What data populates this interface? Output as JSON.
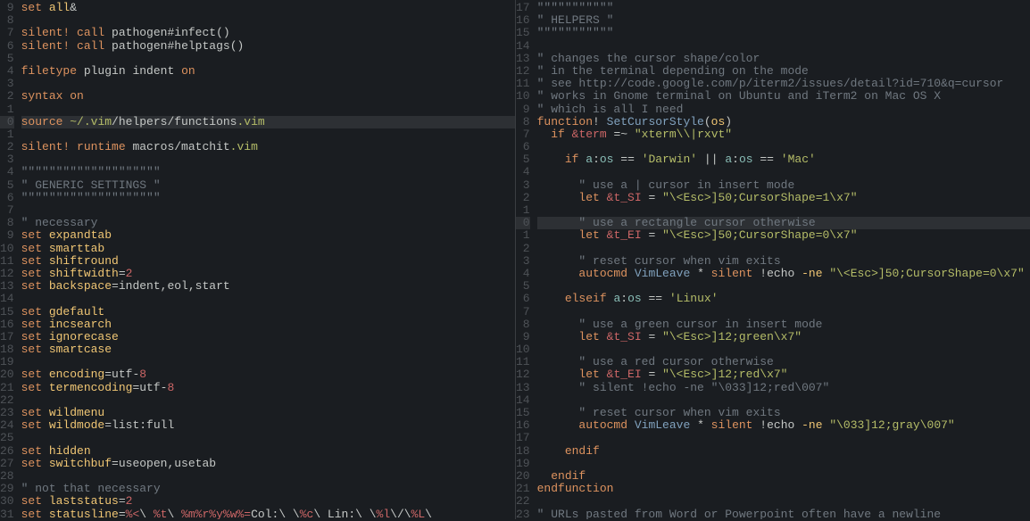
{
  "left": {
    "gutter": [
      "9",
      "8",
      "7",
      "6",
      "5",
      "4",
      "3",
      "2",
      "1",
      "0",
      "1",
      "2",
      "3",
      "4",
      "5",
      "6",
      "7",
      "8",
      "9",
      "10",
      "11",
      "12",
      "13",
      "14",
      "15",
      "16",
      "17",
      "18",
      "19",
      "20",
      "21",
      "22",
      "23",
      "24",
      "25",
      "26",
      "27",
      "28",
      "29",
      "30",
      "31"
    ],
    "cursor_row": 9,
    "lines": [
      [
        [
          "kw",
          "set"
        ],
        [
          "op",
          " "
        ],
        [
          "id",
          "all"
        ],
        [
          "op",
          "&"
        ]
      ],
      [],
      [
        [
          "kw",
          "silent!"
        ],
        [
          "op",
          " "
        ],
        [
          "kw",
          "call"
        ],
        [
          "op",
          " pathogen#infect"
        ],
        [
          "op",
          "()"
        ]
      ],
      [
        [
          "kw",
          "silent!"
        ],
        [
          "op",
          " "
        ],
        [
          "kw",
          "call"
        ],
        [
          "op",
          " pathogen#helptags"
        ],
        [
          "op",
          "()"
        ]
      ],
      [],
      [
        [
          "kw",
          "filetype"
        ],
        [
          "op",
          " plugin indent "
        ],
        [
          "kw",
          "on"
        ]
      ],
      [],
      [
        [
          "kw",
          "syntax"
        ],
        [
          "op",
          " "
        ],
        [
          "kw",
          "on"
        ]
      ],
      [],
      [
        [
          "kw",
          "source"
        ],
        [
          "op",
          " "
        ],
        [
          "str",
          "~/.vim"
        ],
        [
          "op",
          "/helpers/functions"
        ],
        [
          "str",
          ".vim"
        ]
      ],
      [],
      [
        [
          "kw",
          "silent!"
        ],
        [
          "op",
          " "
        ],
        [
          "kw",
          "runtime"
        ],
        [
          "op",
          " macros/matchit"
        ],
        [
          "str",
          ".vim"
        ]
      ],
      [],
      [
        [
          "cmt",
          "\"\"\"\"\"\"\"\"\"\"\"\"\"\"\"\"\"\"\"\""
        ]
      ],
      [
        [
          "cmt",
          "\" GENERIC SETTINGS \""
        ]
      ],
      [
        [
          "cmt",
          "\"\"\"\"\"\"\"\"\"\"\"\"\"\"\"\"\"\"\"\""
        ]
      ],
      [],
      [
        [
          "cmt",
          "\" necessary"
        ]
      ],
      [
        [
          "kw",
          "set"
        ],
        [
          "op",
          " "
        ],
        [
          "id",
          "expandtab"
        ]
      ],
      [
        [
          "kw",
          "set"
        ],
        [
          "op",
          " "
        ],
        [
          "id",
          "smarttab"
        ]
      ],
      [
        [
          "kw",
          "set"
        ],
        [
          "op",
          " "
        ],
        [
          "id",
          "shiftround"
        ]
      ],
      [
        [
          "kw",
          "set"
        ],
        [
          "op",
          " "
        ],
        [
          "id",
          "shiftwidth"
        ],
        [
          "op",
          "="
        ],
        [
          "num",
          "2"
        ]
      ],
      [
        [
          "kw",
          "set"
        ],
        [
          "op",
          " "
        ],
        [
          "id",
          "backspace"
        ],
        [
          "op",
          "=indent,eol,start"
        ]
      ],
      [],
      [
        [
          "kw",
          "set"
        ],
        [
          "op",
          " "
        ],
        [
          "id",
          "gdefault"
        ]
      ],
      [
        [
          "kw",
          "set"
        ],
        [
          "op",
          " "
        ],
        [
          "id",
          "incsearch"
        ]
      ],
      [
        [
          "kw",
          "set"
        ],
        [
          "op",
          " "
        ],
        [
          "id",
          "ignorecase"
        ]
      ],
      [
        [
          "kw",
          "set"
        ],
        [
          "op",
          " "
        ],
        [
          "id",
          "smartcase"
        ]
      ],
      [],
      [
        [
          "kw",
          "set"
        ],
        [
          "op",
          " "
        ],
        [
          "id",
          "encoding"
        ],
        [
          "op",
          "=utf-"
        ],
        [
          "num",
          "8"
        ]
      ],
      [
        [
          "kw",
          "set"
        ],
        [
          "op",
          " "
        ],
        [
          "id",
          "termencoding"
        ],
        [
          "op",
          "=utf-"
        ],
        [
          "num",
          "8"
        ]
      ],
      [],
      [
        [
          "kw",
          "set"
        ],
        [
          "op",
          " "
        ],
        [
          "id",
          "wildmenu"
        ]
      ],
      [
        [
          "kw",
          "set"
        ],
        [
          "op",
          " "
        ],
        [
          "id",
          "wildmode"
        ],
        [
          "op",
          "=list:full"
        ]
      ],
      [],
      [
        [
          "kw",
          "set"
        ],
        [
          "op",
          " "
        ],
        [
          "id",
          "hidden"
        ]
      ],
      [
        [
          "kw",
          "set"
        ],
        [
          "op",
          " "
        ],
        [
          "id",
          "switchbuf"
        ],
        [
          "op",
          "=useopen,usetab"
        ]
      ],
      [],
      [
        [
          "cmt",
          "\" not that necessary"
        ]
      ],
      [
        [
          "kw",
          "set"
        ],
        [
          "op",
          " "
        ],
        [
          "id",
          "laststatus"
        ],
        [
          "op",
          "="
        ],
        [
          "num",
          "2"
        ]
      ],
      [
        [
          "kw",
          "set"
        ],
        [
          "op",
          " "
        ],
        [
          "id",
          "statusline"
        ],
        [
          "op",
          "="
        ],
        [
          "amp",
          "%<"
        ],
        [
          "op",
          "\\ "
        ],
        [
          "amp",
          "%t"
        ],
        [
          "op",
          "\\ "
        ],
        [
          "amp",
          "%m%r%y%w%="
        ],
        [
          "op",
          "Col:\\ \\"
        ],
        [
          "amp",
          "%c"
        ],
        [
          "op",
          "\\ Lin:\\ \\"
        ],
        [
          "amp",
          "%l"
        ],
        [
          "op",
          "\\/\\"
        ],
        [
          "amp",
          "%L"
        ],
        [
          "op",
          "\\"
        ]
      ]
    ]
  },
  "right": {
    "gutter": [
      "17",
      "16",
      "15",
      "14",
      "13",
      "12",
      "11",
      "10",
      "9",
      "8",
      "7",
      "6",
      "5",
      "4",
      "3",
      "2",
      "1",
      "0",
      "1",
      "2",
      "3",
      "4",
      "5",
      "6",
      "7",
      "8",
      "9",
      "10",
      "11",
      "12",
      "13",
      "14",
      "15",
      "16",
      "17",
      "18",
      "19",
      "20",
      "21",
      "22",
      "23"
    ],
    "cursor_row": 17,
    "lines": [
      [
        [
          "cmt",
          "\"\"\"\"\"\"\"\"\"\"\""
        ]
      ],
      [
        [
          "cmt",
          "\" HELPERS \""
        ]
      ],
      [
        [
          "cmt",
          "\"\"\"\"\"\"\"\"\"\"\""
        ]
      ],
      [],
      [
        [
          "cmt",
          "\" changes the cursor shape/color"
        ]
      ],
      [
        [
          "cmt",
          "\" in the terminal depending on the mode"
        ]
      ],
      [
        [
          "cmt",
          "\" see http://code.google.com/p/iterm2/issues/detail?id=710&q=cursor"
        ]
      ],
      [
        [
          "cmt",
          "\" works in Gnome terminal on Ubuntu and iTerm2 on Mac OS X"
        ]
      ],
      [
        [
          "cmt",
          "\" which is all I need"
        ]
      ],
      [
        [
          "kw",
          "function"
        ],
        [
          "op",
          "! "
        ],
        [
          "fn",
          "SetCursorStyle"
        ],
        [
          "op",
          "("
        ],
        [
          "id",
          "os"
        ],
        [
          "op",
          ")"
        ]
      ],
      [
        [
          "op",
          "  "
        ],
        [
          "kw",
          "if"
        ],
        [
          "op",
          " "
        ],
        [
          "amp",
          "&term"
        ],
        [
          "op",
          " =~ "
        ],
        [
          "str",
          "\"xterm\\\\|rxvt\""
        ]
      ],
      [],
      [
        [
          "op",
          "    "
        ],
        [
          "kw",
          "if"
        ],
        [
          "op",
          " "
        ],
        [
          "var",
          "a"
        ],
        [
          "op",
          ":"
        ],
        [
          "var",
          "os"
        ],
        [
          "op",
          " == "
        ],
        [
          "str",
          "'Darwin'"
        ],
        [
          "op",
          " || "
        ],
        [
          "var",
          "a"
        ],
        [
          "op",
          ":"
        ],
        [
          "var",
          "os"
        ],
        [
          "op",
          " == "
        ],
        [
          "str",
          "'Mac'"
        ]
      ],
      [],
      [
        [
          "op",
          "      "
        ],
        [
          "cmt",
          "\" use a | cursor in insert mode"
        ]
      ],
      [
        [
          "op",
          "      "
        ],
        [
          "kw",
          "let"
        ],
        [
          "op",
          " "
        ],
        [
          "amp",
          "&t_SI"
        ],
        [
          "op",
          " = "
        ],
        [
          "str",
          "\"\\<Esc>]50;CursorShape=1\\x7\""
        ]
      ],
      [],
      [
        [
          "op",
          "      "
        ],
        [
          "cmt",
          "\" use a rectangle cursor otherwise"
        ]
      ],
      [
        [
          "op",
          "      "
        ],
        [
          "kw",
          "let"
        ],
        [
          "op",
          " "
        ],
        [
          "amp",
          "&t_EI"
        ],
        [
          "op",
          " = "
        ],
        [
          "str",
          "\"\\<Esc>]50;CursorShape=0\\x7\""
        ]
      ],
      [],
      [
        [
          "op",
          "      "
        ],
        [
          "cmt",
          "\" reset cursor when vim exits"
        ]
      ],
      [
        [
          "op",
          "      "
        ],
        [
          "kw",
          "autocmd"
        ],
        [
          "op",
          " "
        ],
        [
          "fn",
          "VimLeave"
        ],
        [
          "op",
          " * "
        ],
        [
          "kw",
          "silent"
        ],
        [
          "op",
          " !echo "
        ],
        [
          "id",
          "-ne"
        ],
        [
          "op",
          " "
        ],
        [
          "str",
          "\"\\<Esc>]50;CursorShape=0\\x7\""
        ]
      ],
      [],
      [
        [
          "op",
          "    "
        ],
        [
          "kw",
          "elseif"
        ],
        [
          "op",
          " "
        ],
        [
          "var",
          "a"
        ],
        [
          "op",
          ":"
        ],
        [
          "var",
          "os"
        ],
        [
          "op",
          " == "
        ],
        [
          "str",
          "'Linux'"
        ]
      ],
      [],
      [
        [
          "op",
          "      "
        ],
        [
          "cmt",
          "\" use a green cursor in insert mode"
        ]
      ],
      [
        [
          "op",
          "      "
        ],
        [
          "kw",
          "let"
        ],
        [
          "op",
          " "
        ],
        [
          "amp",
          "&t_SI"
        ],
        [
          "op",
          " = "
        ],
        [
          "str",
          "\"\\<Esc>]12;green\\x7\""
        ]
      ],
      [],
      [
        [
          "op",
          "      "
        ],
        [
          "cmt",
          "\" use a red cursor otherwise"
        ]
      ],
      [
        [
          "op",
          "      "
        ],
        [
          "kw",
          "let"
        ],
        [
          "op",
          " "
        ],
        [
          "amp",
          "&t_EI"
        ],
        [
          "op",
          " = "
        ],
        [
          "str",
          "\"\\<Esc>]12;red\\x7\""
        ]
      ],
      [
        [
          "op",
          "      "
        ],
        [
          "cmt",
          "\" silent !echo -ne \"\\033]12;red\\007\""
        ]
      ],
      [],
      [
        [
          "op",
          "      "
        ],
        [
          "cmt",
          "\" reset cursor when vim exits"
        ]
      ],
      [
        [
          "op",
          "      "
        ],
        [
          "kw",
          "autocmd"
        ],
        [
          "op",
          " "
        ],
        [
          "fn",
          "VimLeave"
        ],
        [
          "op",
          " * "
        ],
        [
          "kw",
          "silent"
        ],
        [
          "op",
          " !echo "
        ],
        [
          "id",
          "-ne"
        ],
        [
          "op",
          " "
        ],
        [
          "str",
          "\"\\033]12;gray\\007\""
        ]
      ],
      [],
      [
        [
          "op",
          "    "
        ],
        [
          "kw",
          "endif"
        ]
      ],
      [],
      [
        [
          "op",
          "  "
        ],
        [
          "kw",
          "endif"
        ]
      ],
      [
        [
          "kw",
          "endfunction"
        ]
      ],
      [],
      [
        [
          "cmt",
          "\" URLs pasted from Word or Powerpoint often have a newline"
        ]
      ]
    ]
  }
}
